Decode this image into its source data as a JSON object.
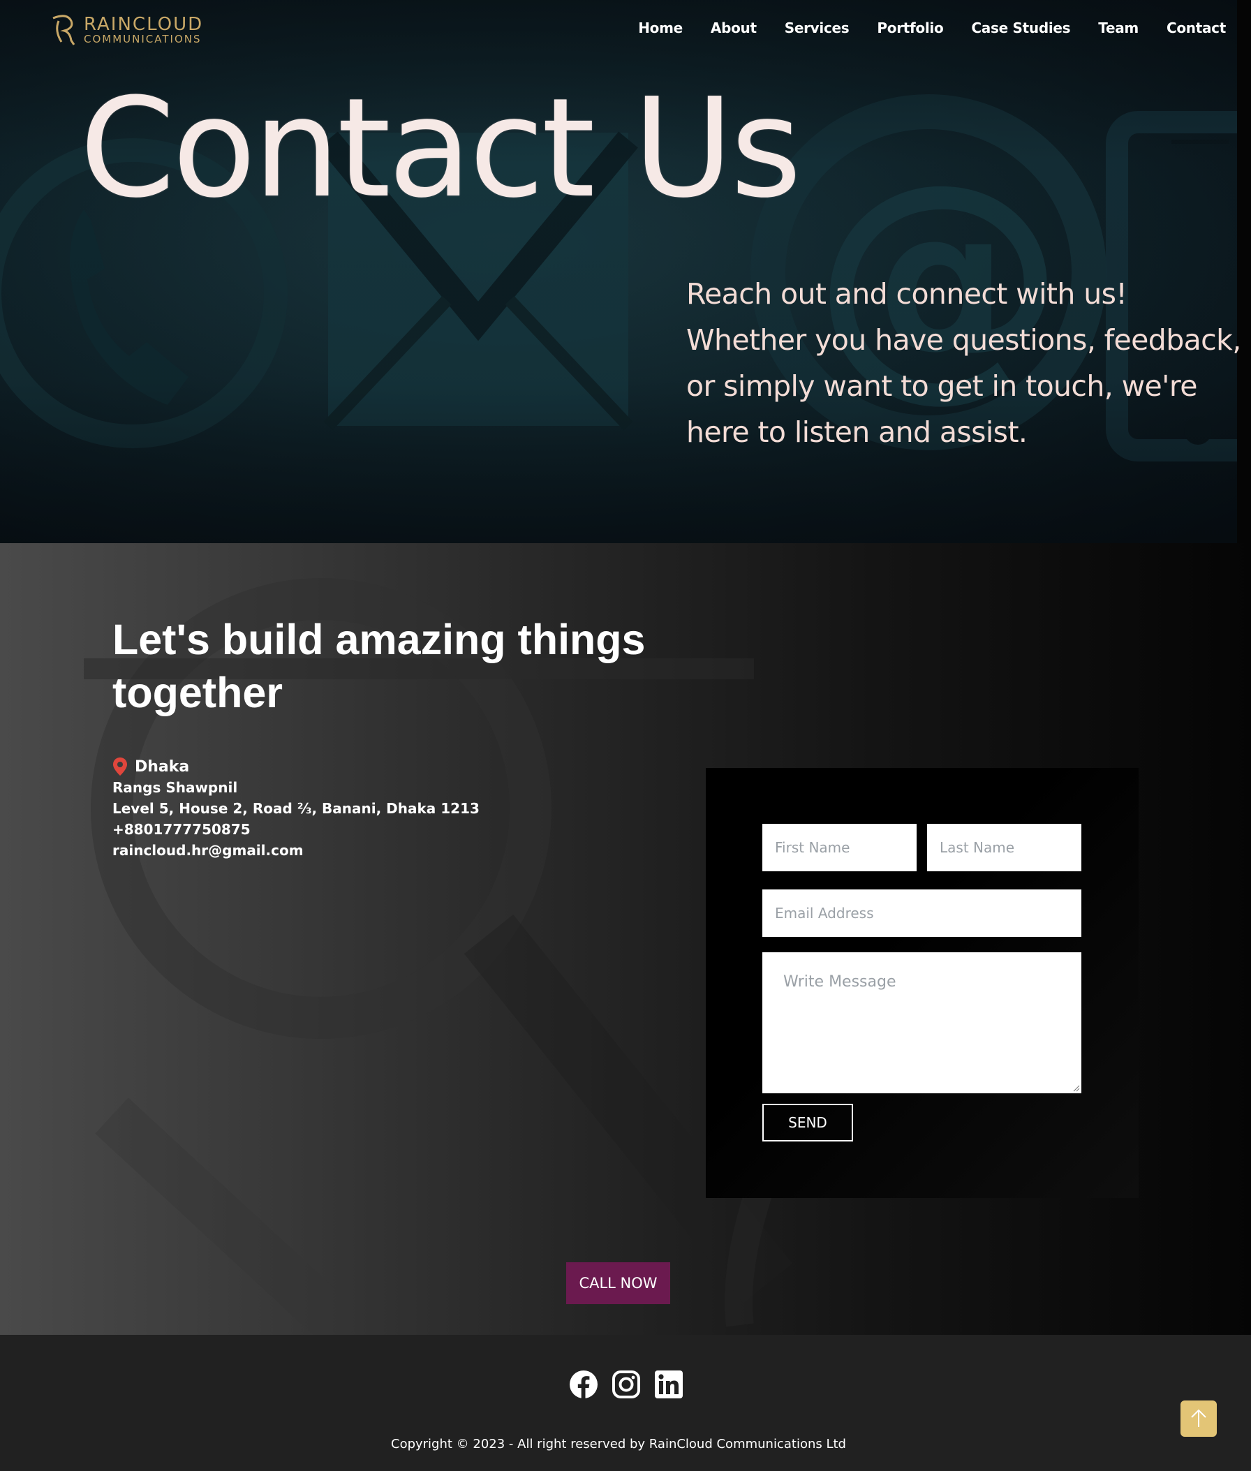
{
  "brand": {
    "name": "RAINCLOUD",
    "sub": "COMMUNICATIONS",
    "color": "#c9a867"
  },
  "nav": {
    "items": [
      {
        "label": "Home"
      },
      {
        "label": "About"
      },
      {
        "label": "Services"
      },
      {
        "label": "Portfolio"
      },
      {
        "label": "Case Studies"
      },
      {
        "label": "Team"
      },
      {
        "label": "Contact"
      }
    ]
  },
  "hero": {
    "title": "Contact Us",
    "text": "Reach out and connect with us! Whether you have questions, feedback, or simply want to get in touch, we're here to listen and assist."
  },
  "contact": {
    "heading": "Let's build amazing things together",
    "city": "Dhaka",
    "address_lines": [
      "Rangs Shawpnil",
      "Level 5, House 2, Road ⅔, Banani, Dhaka 1213",
      "+8801777750875",
      "raincloud.hr@gmail.com"
    ],
    "pin_color": "#e0463c"
  },
  "form": {
    "first_name_placeholder": "First Name",
    "last_name_placeholder": "Last Name",
    "email_placeholder": "Email Address",
    "message_placeholder": "Write Message",
    "send_label": "SEND"
  },
  "call": {
    "label": "CALL NOW",
    "color": "#6b1a4f"
  },
  "footer": {
    "socials": [
      "facebook-icon",
      "instagram-icon",
      "linkedin-icon"
    ],
    "copyright": "Copyright © 2023 - All right reserved by RainCloud Communications Ltd",
    "to_top_color": "#e3c576"
  }
}
